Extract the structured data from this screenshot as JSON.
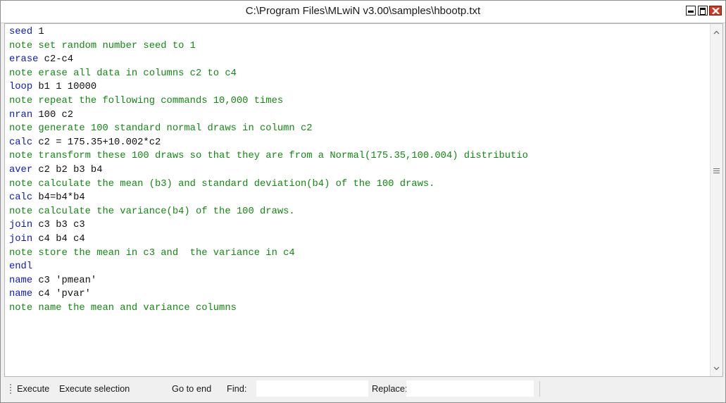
{
  "window": {
    "title": "C:\\Program Files\\MLwiN v3.00\\samples\\hbootp.txt",
    "controls": [
      "minimize-icon",
      "maximize-icon",
      "close-icon"
    ],
    "close_color": "#d9341f"
  },
  "editor": {
    "lines": [
      {
        "kw": "seed",
        "rest": " 1",
        "type": "cmd"
      },
      {
        "kw": "",
        "rest": "note set random number seed to 1",
        "type": "note"
      },
      {
        "kw": "erase",
        "rest": " c2-c4",
        "type": "cmd"
      },
      {
        "kw": "",
        "rest": "note erase all data in columns c2 to c4",
        "type": "note"
      },
      {
        "kw": "loop",
        "rest": " b1 1 10000",
        "type": "cmd"
      },
      {
        "kw": "",
        "rest": "note repeat the following commands 10,000 times",
        "type": "note"
      },
      {
        "kw": "nran",
        "rest": " 100 c2",
        "type": "cmd"
      },
      {
        "kw": "",
        "rest": "note generate 100 standard normal draws in column c2",
        "type": "note"
      },
      {
        "kw": "calc",
        "rest": " c2 = 175.35+10.002*c2",
        "type": "cmd"
      },
      {
        "kw": "",
        "rest": "note transform these 100 draws so that they are from a Normal(175.35,100.004) distributio",
        "type": "note"
      },
      {
        "kw": "aver",
        "rest": " c2 b2 b3 b4",
        "type": "cmd"
      },
      {
        "kw": "",
        "rest": "note calculate the mean (b3) and standard deviation(b4) of the 100 draws.",
        "type": "note"
      },
      {
        "kw": "calc",
        "rest": " b4=b4*b4",
        "type": "cmd"
      },
      {
        "kw": "",
        "rest": "note calculate the variance(b4) of the 100 draws.",
        "type": "note"
      },
      {
        "kw": "join",
        "rest": " c3 b3 c3",
        "type": "cmd"
      },
      {
        "kw": "join",
        "rest": " c4 b4 c4",
        "type": "cmd"
      },
      {
        "kw": "",
        "rest": "note store the mean in c3 and  the variance in c4",
        "type": "note"
      },
      {
        "kw": "endl",
        "rest": "",
        "type": "cmd"
      },
      {
        "kw": "name",
        "rest": " c3 'pmean'",
        "type": "cmd"
      },
      {
        "kw": "name",
        "rest": " c4 'pvar'",
        "type": "cmd"
      },
      {
        "kw": "",
        "rest": "note name the mean and variance columns",
        "type": "note"
      }
    ],
    "colors": {
      "keyword": "#0a18c8",
      "argument": "#111111",
      "note": "#108a10"
    }
  },
  "toolbar": {
    "execute_label": "Execute",
    "execute_selection_label": "Execute selection",
    "go_to_end_label": "Go to end",
    "find_label": "Find:",
    "find_value": "",
    "replace_label": "Replace:",
    "replace_value": ""
  }
}
